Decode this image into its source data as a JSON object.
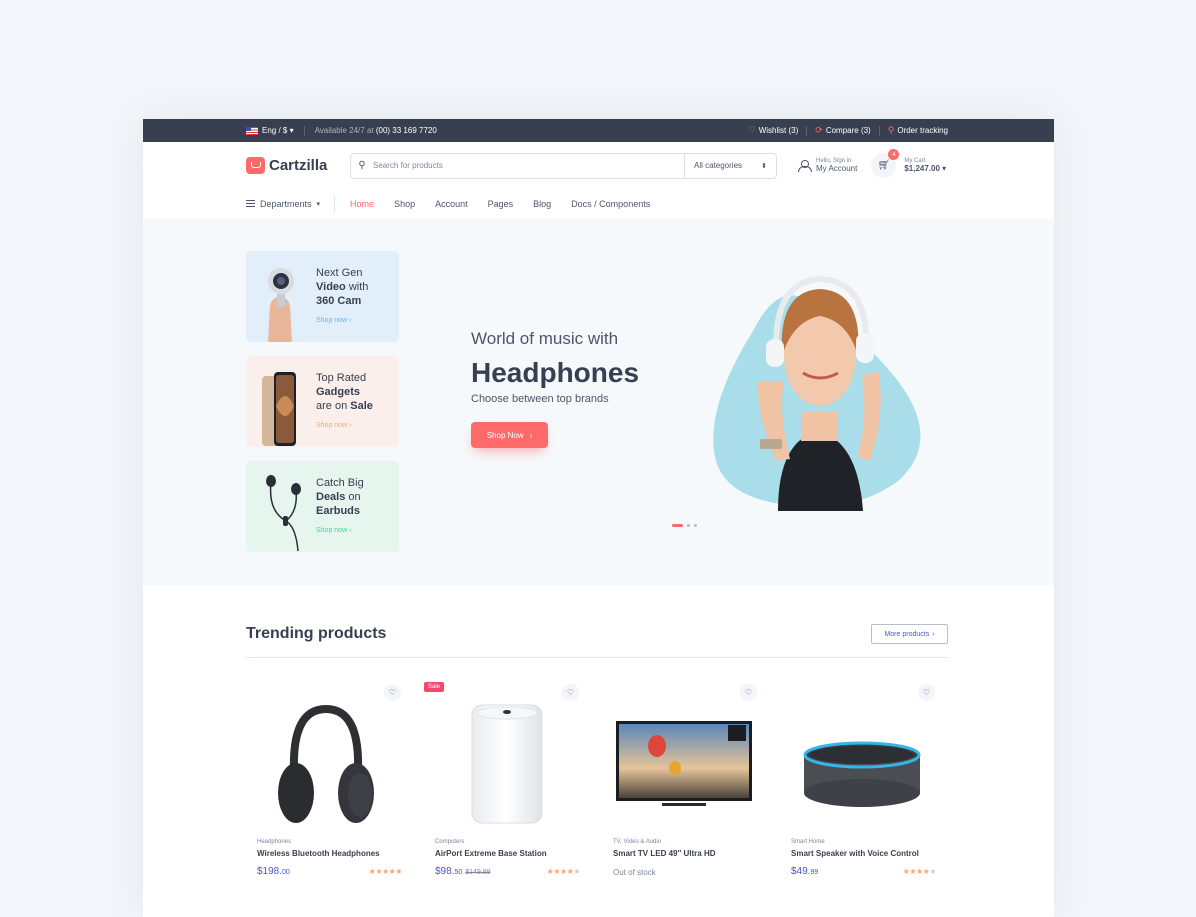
{
  "topbar": {
    "language": "Eng / $",
    "availability_prefix": "Available 24/7 at",
    "phone": "(00) 33 169 7720",
    "wishlist": "Wishlist (3)",
    "compare": "Compare (3)",
    "order_tracking": "Order tracking"
  },
  "header": {
    "logo": "Cartzilla",
    "search_placeholder": "Search for products",
    "category_select": "All categories",
    "account_greeting": "Hello, Sign in",
    "account_label": "My Account",
    "cart_count": "4",
    "cart_label": "My Cart",
    "cart_total": "$1,247.00"
  },
  "nav": {
    "departments": "Departments",
    "links": [
      "Home",
      "Shop",
      "Account",
      "Pages",
      "Blog",
      "Docs / Components"
    ],
    "active": "Home"
  },
  "promos": [
    {
      "line1": "Next Gen",
      "line2_bold": "Video",
      "line2_rest": " with",
      "line3_bold": "360 Cam",
      "line3_rest": "",
      "link": "Shop now",
      "color": "#69b3fe"
    },
    {
      "line1": "Top Rated",
      "line2_bold": "Gadgets",
      "line2_rest": "",
      "line3_pre": "are on ",
      "line3_bold": "Sale",
      "link": "Shop now",
      "color": "#fea569"
    },
    {
      "line1": "Catch Big",
      "line2_bold": "Deals",
      "line2_rest": " on",
      "line3_bold": "Earbuds",
      "line3_rest": "",
      "link": "Shop now",
      "color": "#42d697"
    }
  ],
  "hero": {
    "subtitle": "World of music with",
    "title": "Headphones",
    "description": "Choose between top brands",
    "button": "Shop Now"
  },
  "trending": {
    "title": "Trending products",
    "more_button": "More products",
    "products": [
      {
        "category": "Headphones",
        "name": "Wireless Bluetooth Headphones",
        "price_main": "$198.",
        "price_cents": "00",
        "old_price": "",
        "stock": "",
        "rating": 5,
        "sale": ""
      },
      {
        "category": "Computers",
        "name": "AirPort Extreme Base Station",
        "price_main": "$98.",
        "price_cents": "50",
        "old_price": "$149.99",
        "stock": "",
        "rating": 4,
        "sale": "Sale"
      },
      {
        "category": "TV, Video & Audio",
        "name": "Smart TV LED 49'' Ultra HD",
        "price_main": "",
        "price_cents": "",
        "old_price": "",
        "stock": "Out of stock",
        "rating": 0,
        "sale": ""
      },
      {
        "category": "Smart Home",
        "name": "Smart Speaker with Voice Control",
        "price_main": "$49.",
        "price_cents": "99",
        "old_price": "",
        "stock": "",
        "rating": 4,
        "sale": ""
      }
    ]
  },
  "colors": {
    "accent": "#fe696a",
    "dark": "#373f50",
    "price": "#4e54c8",
    "star": "#fea569"
  }
}
